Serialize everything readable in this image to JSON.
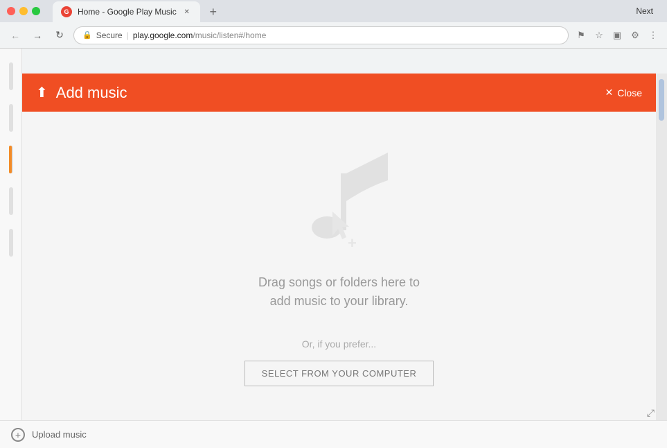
{
  "browser": {
    "title": "Home - Google Play Music",
    "tab_label": "Home - Google Play Music",
    "url_secure": "Secure",
    "url_full": "https://play.google.com/music/listen#/home",
    "url_domain": "play.google.com",
    "url_path": "/music/listen#/home",
    "next_button": "Next",
    "back_icon": "◀",
    "forward_icon": "▶",
    "refresh_icon": "↻"
  },
  "modal": {
    "title": "Add music",
    "close_label": "Close",
    "drag_text_line1": "Drag songs or folders here to",
    "drag_text_line2": "add music to your library.",
    "or_text": "Or, if you prefer...",
    "select_button": "SELECT FROM YOUR COMPUTER"
  },
  "bottom_bar": {
    "upload_label": "Upload music"
  },
  "icons": {
    "upload": "⬆",
    "close_x": "✕",
    "plus": "+",
    "shield": "🔒",
    "star": "☆",
    "cast": "▣",
    "question": "?",
    "menu": "⋮",
    "flag": "⚑",
    "expand": "⤢"
  },
  "colors": {
    "header_bg": "#f04e23",
    "tab_active_bg": "#f1f3f4",
    "url_bar_bg": "#ffffff"
  }
}
